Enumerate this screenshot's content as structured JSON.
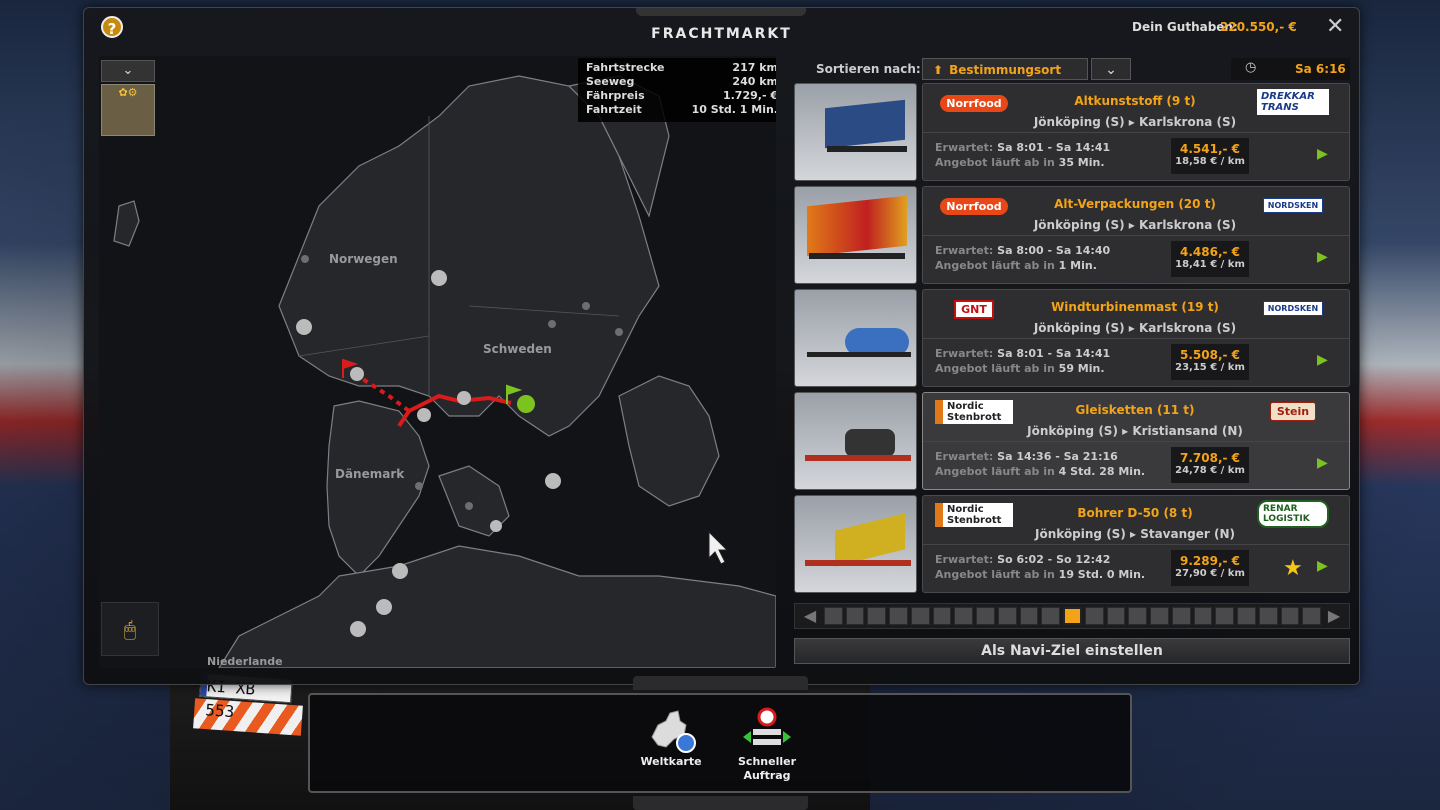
{
  "window": {
    "title": "FRACHTMARKT",
    "balance_label": "Dein Guthaben:",
    "balance_value": "220.550,- €",
    "help_icon": "?",
    "close_icon": "✕"
  },
  "map": {
    "dropdown_icon": "⌄",
    "filter_icon": "✿⚙",
    "route_info": [
      {
        "label": "Fahrtstrecke",
        "value": "217 km"
      },
      {
        "label": "Seeweg",
        "value": "240 km"
      },
      {
        "label": "Fährpreis",
        "value": "1.729,- €"
      },
      {
        "label": "Fahrtzeit",
        "value": "10 Std. 1 Min."
      }
    ],
    "countries": {
      "norway": "Norwegen",
      "sweden": "Schweden",
      "denmark": "Dänemark",
      "netherlands": "Niederlande"
    },
    "mouse_icon": "🖱"
  },
  "sort": {
    "label": "Sortieren nach:",
    "selected": "Bestimmungsort",
    "arrow_icon": "⬆",
    "dropdown_icon": "⌄"
  },
  "clock": {
    "icon": "◷",
    "time": "Sa 6:16"
  },
  "labels": {
    "expected": "Erwartet:",
    "offer_prefix": "Angebot läuft ab in"
  },
  "jobs": [
    {
      "company": "Norrfood",
      "cargo": "Altkunststoff (9 t)",
      "route": "Jönköping (S)  ▸  Karlskrona (S)",
      "expected": "Sa 8:01 - Sa 14:41",
      "offer": "35 Min.",
      "price": "4.541,- €",
      "rate": "18,58 € / km",
      "recipient": "DREKKAR TRANS",
      "thumb_color": "#2a4b84"
    },
    {
      "company": "Norrfood",
      "cargo": "Alt-Verpackungen (20 t)",
      "route": "Jönköping (S)  ▸  Karlskrona (S)",
      "expected": "Sa 8:00 - Sa 14:40",
      "offer": "1 Min.",
      "price": "4.486,- €",
      "rate": "18,41 € / km",
      "recipient": "NORDSKEN",
      "thumb_color": "#e07a18"
    },
    {
      "company": "GNT",
      "cargo": "Windturbinenmast (19 t)",
      "route": "Jönköping (S)  ▸  Karlskrona (S)",
      "expected": "Sa 8:01 - Sa 14:41",
      "offer": "59 Min.",
      "price": "5.508,- €",
      "rate": "23,15 € / km",
      "recipient": "NORDSKEN",
      "thumb_color": "#3b70c0"
    },
    {
      "company": "Nordic Stenbrott",
      "cargo": "Gleisketten (11 t)",
      "route": "Jönköping (S)  ▸  Kristiansand (N)",
      "expected": "Sa 14:36 - Sa 21:16",
      "offer": "4 Std. 28 Min.",
      "price": "7.708,- €",
      "rate": "24,78 € / km",
      "recipient": "Stein",
      "thumb_color": "#444444"
    },
    {
      "company": "Nordic Stenbrott",
      "cargo": "Bohrer D-50 (8 t)",
      "route": "Jönköping (S)  ▸  Stavanger (N)",
      "expected": "So 6:02 - So 12:42",
      "offer": "19 Std. 0 Min.",
      "price": "9.289,- €",
      "rate": "27,90 € / km",
      "recipient": "RENAR LOGISTIK",
      "thumb_color": "#d0b020"
    }
  ],
  "job_arrow_icon": "▶",
  "star_icon": "★",
  "slider": {
    "prev_icon": "◀",
    "next_icon": "▶",
    "selected_index": 11,
    "count": 23
  },
  "navi_button": "Als Navi-Ziel einstellen",
  "bottom_bar": {
    "world_map_label": "Weltkarte",
    "quick_job_label_1": "Schneller",
    "quick_job_label_2": "Auftrag"
  },
  "plate": "KI XB 553",
  "colors": {
    "accent": "#f3a318",
    "go": "#7dc320",
    "route": "#d81c1c"
  }
}
